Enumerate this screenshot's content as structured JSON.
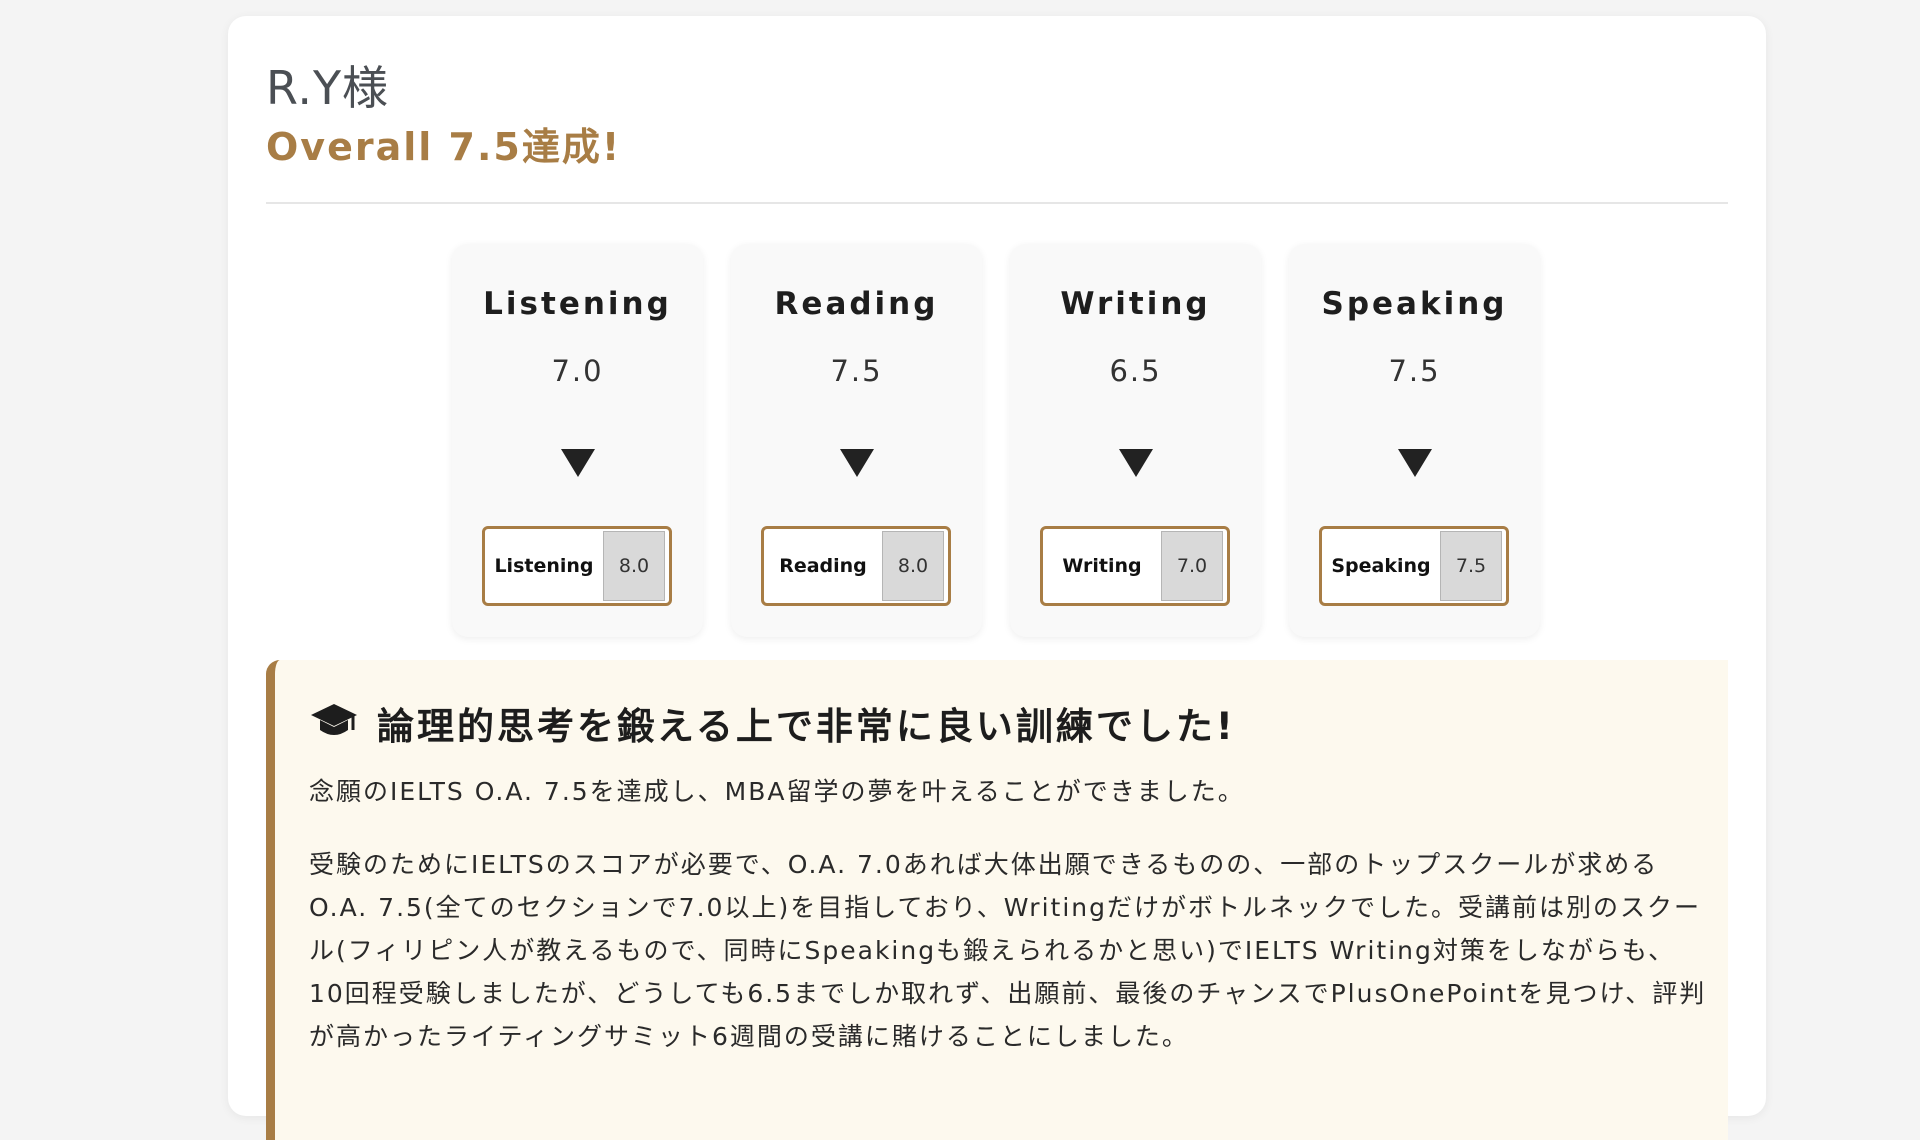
{
  "header": {
    "name": "R.Y様",
    "subtitle": "Overall 7.5達成!"
  },
  "scores": [
    {
      "section": "Listening",
      "before": "7.0",
      "after_label": "Listening",
      "after": "8.0"
    },
    {
      "section": "Reading",
      "before": "7.5",
      "after_label": "Reading",
      "after": "8.0"
    },
    {
      "section": "Writing",
      "before": "6.5",
      "after_label": "Writing",
      "after": "7.0"
    },
    {
      "section": "Speaking",
      "before": "7.5",
      "after_label": "Speaking",
      "after": "7.5"
    }
  ],
  "testimonial": {
    "icon": "graduation-cap-icon",
    "title": "論理的思考を鍛える上で非常に良い訓練でした!",
    "paragraphs": [
      "念願のIELTS O.A. 7.5を達成し、MBA留学の夢を叶えることができました。",
      "受験のためにIELTSのスコアが必要で、O.A. 7.0あれば大体出願できるものの、一部のトップスクールが求めるO.A. 7.5(全てのセクションで7.0以上)を目指しており、Writingだけがボトルネックでした。受講前は別のスクール(フィリピン人が教えるもので、同時にSpeakingも鍛えられるかと思い)でIELTS Writing対策をしながらも、10回程受験しましたが、どうしても6.5までしか取れず、出願前、最後のチャンスでPlusOnePointを見つけ、評判が高かったライティングサミット6週間の受講に賭けることにしました。"
    ]
  },
  "colors": {
    "accent": "#a87d45",
    "testimonial_bg": "#fdf9ee",
    "card_bg": "#ffffff",
    "page_bg": "#f4f4f4"
  }
}
